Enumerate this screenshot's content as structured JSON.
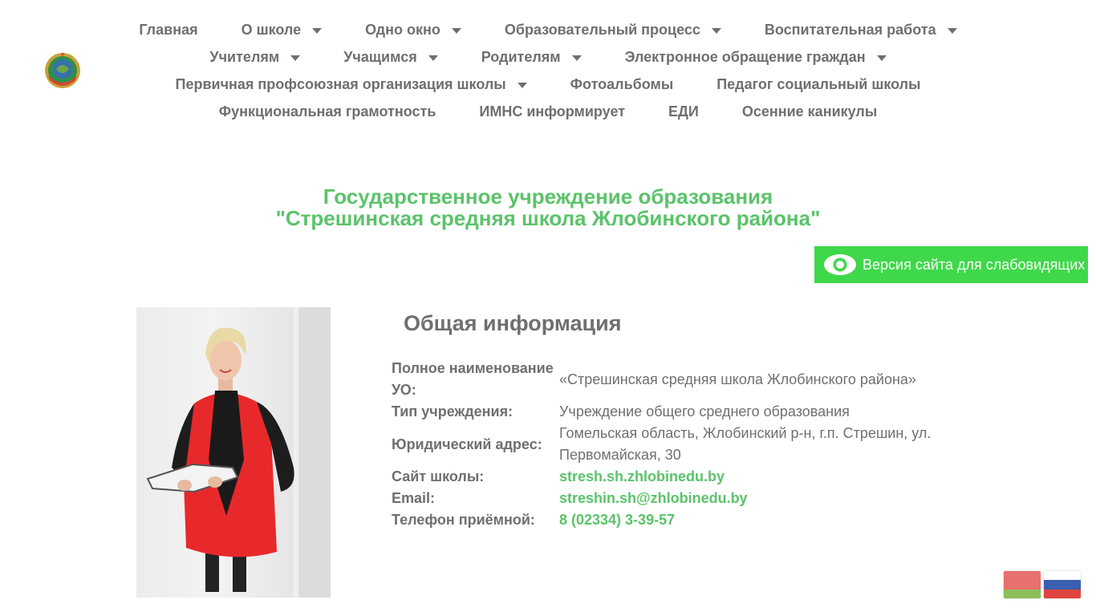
{
  "colors": {
    "accent": "#5bc36a",
    "button": "#3fd84a",
    "text": "#6f6f6f"
  },
  "nav": {
    "rows": [
      [
        {
          "label": "Главная",
          "dropdown": false
        },
        {
          "label": "О школе",
          "dropdown": true
        },
        {
          "label": "Одно окно",
          "dropdown": true
        },
        {
          "label": "Образовательный процесс",
          "dropdown": true
        },
        {
          "label": "Воспитательная работа",
          "dropdown": true
        }
      ],
      [
        {
          "label": "Учителям",
          "dropdown": true
        },
        {
          "label": "Учащимся",
          "dropdown": true
        },
        {
          "label": "Родителям",
          "dropdown": true
        },
        {
          "label": "Электронное обращение граждан",
          "dropdown": true
        }
      ],
      [
        {
          "label": "Первичная профсоюзная организация школы",
          "dropdown": true
        },
        {
          "label": "Фотоальбомы",
          "dropdown": false
        },
        {
          "label": "Педагог социальный школы",
          "dropdown": false
        }
      ],
      [
        {
          "label": "Функциональная грамотность",
          "dropdown": false
        },
        {
          "label": "ИМНС информирует",
          "dropdown": false
        },
        {
          "label": "ЕДИ",
          "dropdown": false
        },
        {
          "label": "Осенние каникулы",
          "dropdown": false
        }
      ]
    ]
  },
  "header": {
    "title_line1": "Государственное учреждение образования",
    "title_line2": "\"Стрешинская средняя школа Жлобинского района\""
  },
  "accessibility": {
    "label": "Версия сайта для слабовидящих",
    "icon": "eye-icon"
  },
  "info": {
    "heading": "Общая информация",
    "rows": [
      {
        "key": "Полное наименование УО:",
        "value": "«Стрешинская средняя школа Жлобинского района»"
      },
      {
        "key": "Тип учреждения:",
        "value": "Учреждение общего среднего образования"
      },
      {
        "key": "Юридический адрес:",
        "value": "Гомельская область, Жлобинский р-н, г.п. Стрешин, ул. Первомайская, 30"
      },
      {
        "key": "Сайт школы:",
        "value": "stresh.sh.zhlobinedu.by",
        "link": true
      },
      {
        "key": "Email:",
        "value": "streshin.sh@zhlobinedu.by",
        "link": true
      },
      {
        "key": "Телефон приёмной:",
        "value": "8 (02334) 3-39-57",
        "link": true
      }
    ]
  },
  "languages": [
    {
      "name": "belarusian-flag",
      "colors": [
        "#e8706e",
        "#8bbf5a"
      ]
    },
    {
      "name": "russian-flag",
      "colors": [
        "#ffffff",
        "#3a5fb0",
        "#e0453f"
      ]
    }
  ]
}
